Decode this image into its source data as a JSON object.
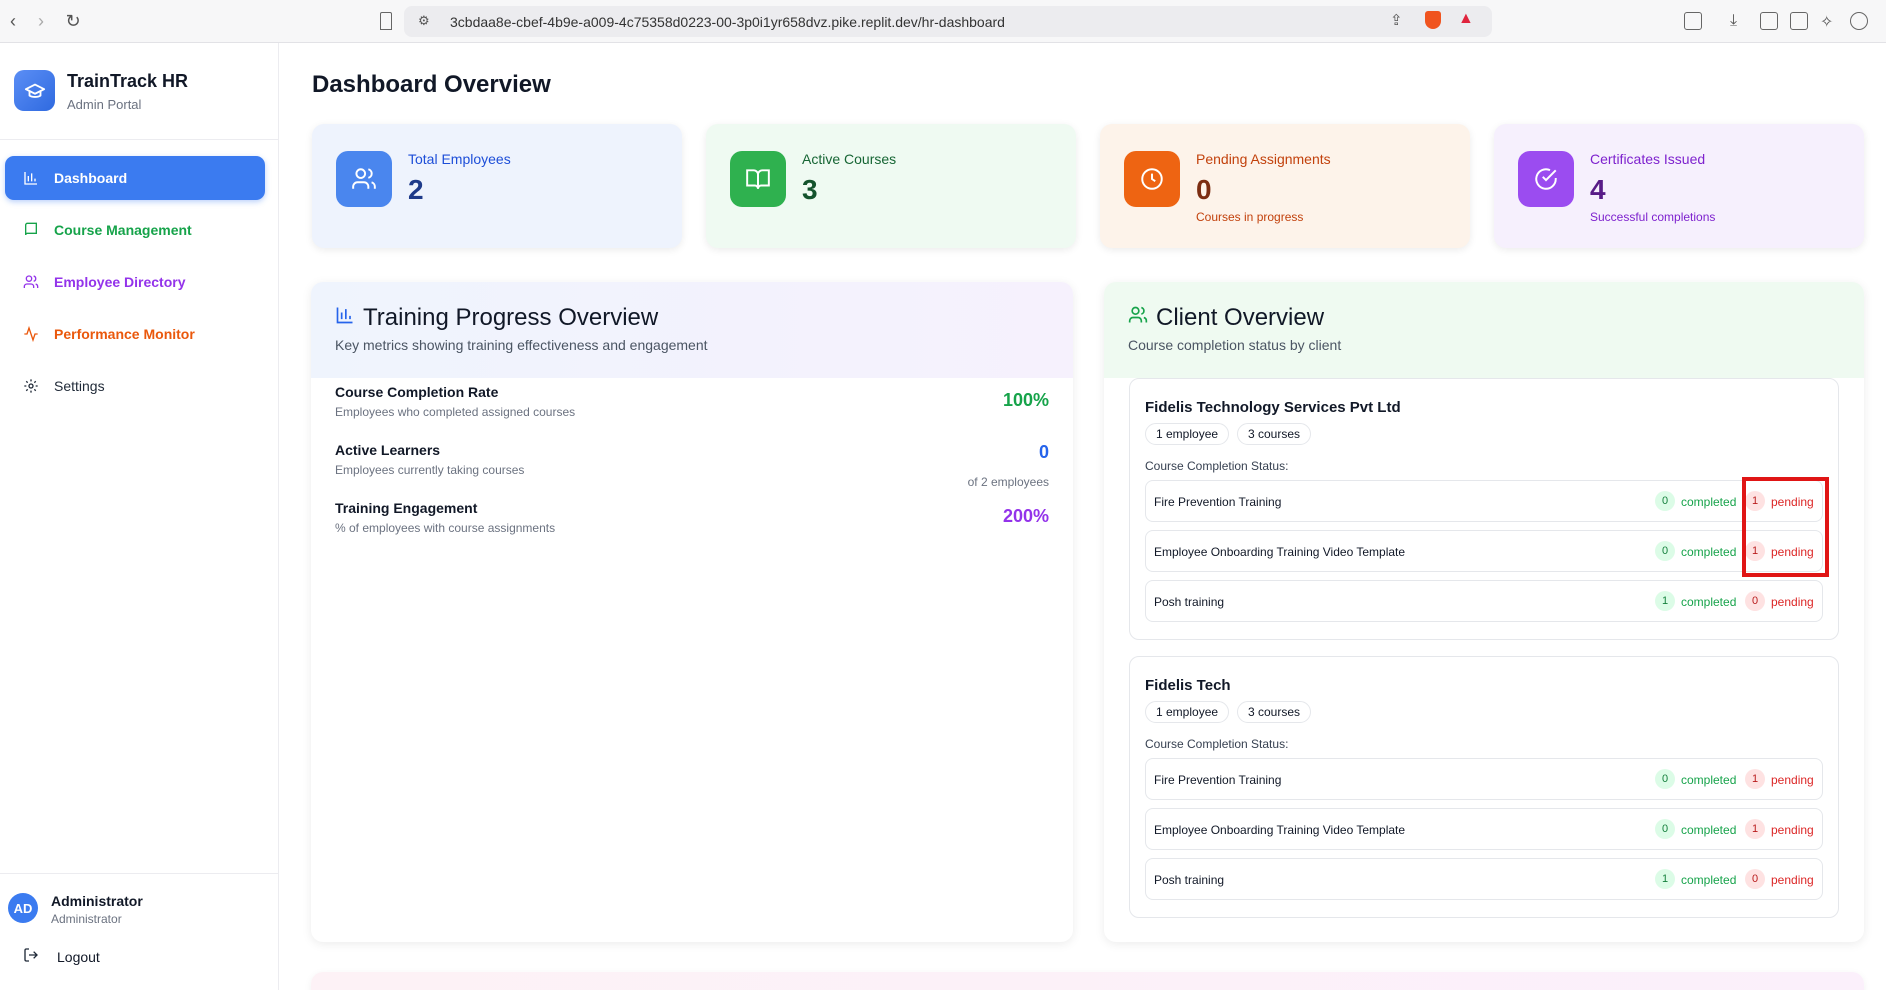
{
  "browser": {
    "url": "3cbdaa8e-cbef-4b9e-a009-4c75358d0223-00-3p0i1yr658dvz.pike.replit.dev/hr-dashboard"
  },
  "sidebar": {
    "brand_title": "TrainTrack HR",
    "brand_subtitle": "Admin Portal",
    "items": [
      {
        "label": "Dashboard",
        "icon": "bar-chart-icon",
        "color": "#ffffff",
        "active": true
      },
      {
        "label": "Course Management",
        "icon": "book-icon",
        "color": "#16a34a",
        "active": false
      },
      {
        "label": "Employee Directory",
        "icon": "users-icon",
        "color": "#9333ea",
        "active": false
      },
      {
        "label": "Performance Monitor",
        "icon": "activity-icon",
        "color": "#ea580c",
        "active": false
      },
      {
        "label": "Settings",
        "icon": "gear-icon",
        "color": "#1f2937",
        "active": false
      }
    ],
    "user": {
      "initials": "AD",
      "name": "Administrator",
      "role": "Administrator"
    },
    "logout_label": "Logout"
  },
  "main": {
    "title": "Dashboard Overview",
    "stats": [
      {
        "label": "Total Employees",
        "value": "2",
        "sub": "",
        "icon": "users-icon",
        "color": "#3b7bf0"
      },
      {
        "label": "Active Courses",
        "value": "3",
        "sub": "",
        "icon": "book-open-icon",
        "color": "#22a447"
      },
      {
        "label": "Pending Assignments",
        "value": "0",
        "sub": "Courses in progress",
        "icon": "clock-icon",
        "color": "#ea580c"
      },
      {
        "label": "Certificates Issued",
        "value": "4",
        "sub": "Successful completions",
        "icon": "check-circle-icon",
        "color": "#9333ea"
      }
    ],
    "training": {
      "title": "Training Progress Overview",
      "subtitle": "Key metrics showing training effectiveness and engagement",
      "metrics": [
        {
          "name": "Course Completion Rate",
          "desc": "Employees who completed assigned courses",
          "value": "100%",
          "extra": "",
          "color": "#16a34a"
        },
        {
          "name": "Active Learners",
          "desc": "Employees currently taking courses",
          "value": "0",
          "extra": "of 2 employees",
          "color": "#2563eb"
        },
        {
          "name": "Training Engagement",
          "desc": "% of employees with course assignments",
          "value": "200%",
          "extra": "",
          "color": "#9333ea"
        }
      ]
    },
    "clients": {
      "title": "Client Overview",
      "subtitle": "Course completion status by client",
      "status_label": "Course Completion Status:",
      "completed_label": "completed",
      "pending_label": "pending",
      "list": [
        {
          "name": "Fidelis Technology Services Pvt Ltd",
          "employees": "1 employee",
          "courses": "3 courses",
          "rows": [
            {
              "course": "Fire Prevention Training",
              "completed": "0",
              "pending": "1"
            },
            {
              "course": "Employee Onboarding Training Video Template",
              "completed": "0",
              "pending": "1"
            },
            {
              "course": "Posh training",
              "completed": "1",
              "pending": "0"
            }
          ]
        },
        {
          "name": "Fidelis Tech",
          "employees": "1 employee",
          "courses": "3 courses",
          "rows": [
            {
              "course": "Fire Prevention Training",
              "completed": "0",
              "pending": "1"
            },
            {
              "course": "Employee Onboarding Training Video Template",
              "completed": "0",
              "pending": "1"
            },
            {
              "course": "Posh training",
              "completed": "1",
              "pending": "0"
            }
          ]
        }
      ]
    }
  }
}
